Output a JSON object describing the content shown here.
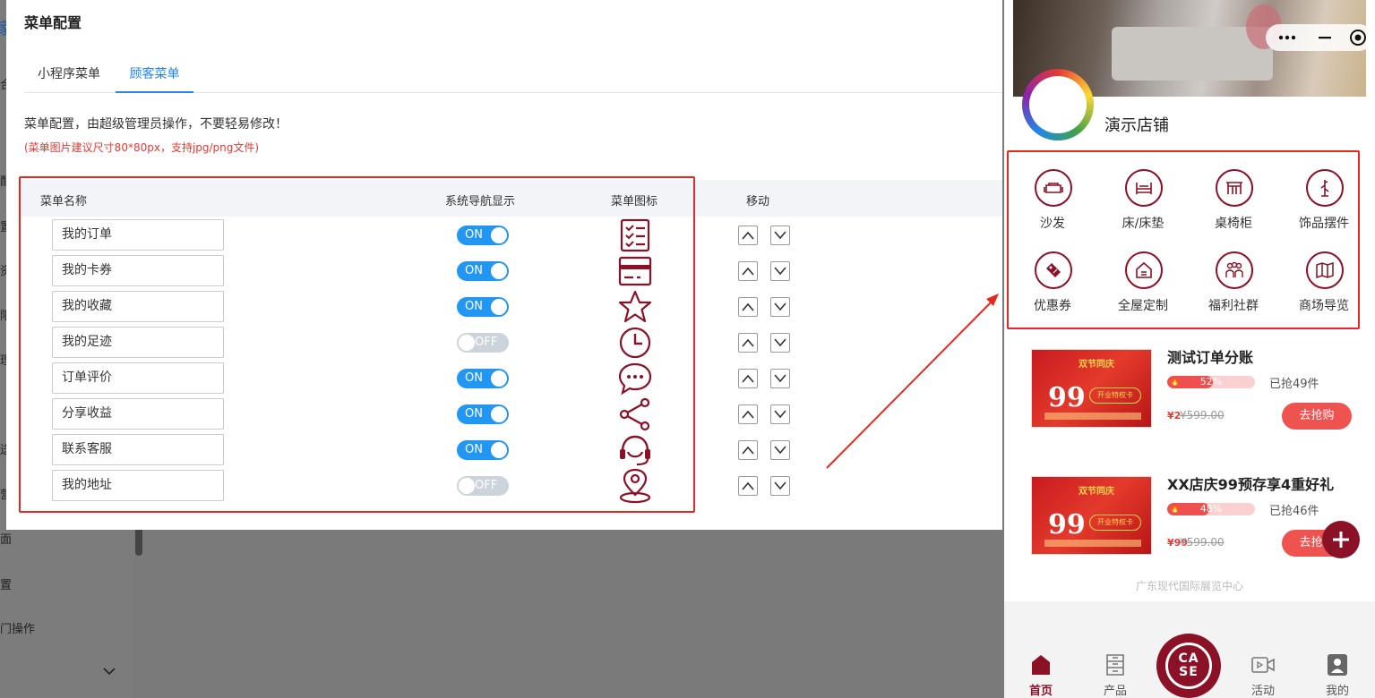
{
  "background": {
    "sidebar_fragments": [
      "合",
      "配",
      "置",
      "资",
      "限",
      "理",
      "送",
      "营",
      "面",
      "置",
      "门操作"
    ],
    "brand_fragment": "家"
  },
  "modal": {
    "title": "菜单配置",
    "tabs": [
      {
        "label": "小程序菜单",
        "active": false
      },
      {
        "label": "顾客菜单",
        "active": true
      }
    ],
    "description": "菜单配置，由超级管理员操作，不要轻易修改！",
    "note": "(菜单图片建议尺寸80*80px，支持jpg/png文件)",
    "table": {
      "headers": {
        "name": "菜单名称",
        "nav_display": "系统导航显示",
        "icon": "菜单图标",
        "move": "移动"
      },
      "rows": [
        {
          "name": "我的订单",
          "toggle": "ON",
          "on": true,
          "icon": "order-list-icon"
        },
        {
          "name": "我的卡券",
          "toggle": "ON",
          "on": true,
          "icon": "card-icon"
        },
        {
          "name": "我的收藏",
          "toggle": "ON",
          "on": true,
          "icon": "star-icon"
        },
        {
          "name": "我的足迹",
          "toggle": "OFF",
          "on": false,
          "icon": "clock-icon"
        },
        {
          "name": "订单评价",
          "toggle": "ON",
          "on": true,
          "icon": "chat-bubble-icon"
        },
        {
          "name": "分享收益",
          "toggle": "ON",
          "on": true,
          "icon": "share-icon"
        },
        {
          "name": "联系客服",
          "toggle": "ON",
          "on": true,
          "icon": "headset-icon"
        },
        {
          "name": "我的地址",
          "toggle": "OFF",
          "on": false,
          "icon": "location-pin-icon"
        }
      ]
    }
  },
  "phone": {
    "store_name": "演示店铺",
    "categories": [
      {
        "label": "沙发",
        "icon": "sofa-icon"
      },
      {
        "label": "床/床垫",
        "icon": "bed-icon"
      },
      {
        "label": "桌椅柜",
        "icon": "table-icon"
      },
      {
        "label": "饰品摆件",
        "icon": "coat-rack-icon"
      },
      {
        "label": "优惠券",
        "icon": "coupon-tag-icon"
      },
      {
        "label": "全屋定制",
        "icon": "house-icon"
      },
      {
        "label": "福利社群",
        "icon": "group-icon"
      },
      {
        "label": "商场导览",
        "icon": "map-icon"
      }
    ],
    "products": [
      {
        "title": "测试订单分账",
        "progress_percent": 52,
        "progress_label": "52%",
        "sold": "已抢49件",
        "price": "¥2",
        "original_price": "¥599.00",
        "buy_label": "去抢购",
        "img_tag": "双节同庆",
        "img_big": "99",
        "img_btn": "开业特权卡"
      },
      {
        "title": "XX店庆99预存享4重好礼",
        "progress_percent": 48,
        "progress_label": "48%",
        "sold": "已抢46件",
        "price": "¥99",
        "original_price": "¥599.00",
        "buy_label": "去抢购",
        "img_tag": "双节同庆",
        "img_big": "99",
        "img_btn": "开业特权卡"
      }
    ],
    "footer_note": "广东现代国际展览中心",
    "tabbar": [
      {
        "label": "首页",
        "active": true,
        "icon": "home-icon"
      },
      {
        "label": "产品",
        "active": false,
        "icon": "product-icon"
      },
      {
        "label": "活动",
        "active": false,
        "icon": "video-icon"
      },
      {
        "label": "我的",
        "active": false,
        "icon": "user-icon"
      }
    ],
    "case_label_top": "CA",
    "case_label_bottom": "SE"
  },
  "colors": {
    "accent_blue": "#2196f3",
    "brand_red": "#8b1127",
    "highlight_red": "#e8281f"
  }
}
